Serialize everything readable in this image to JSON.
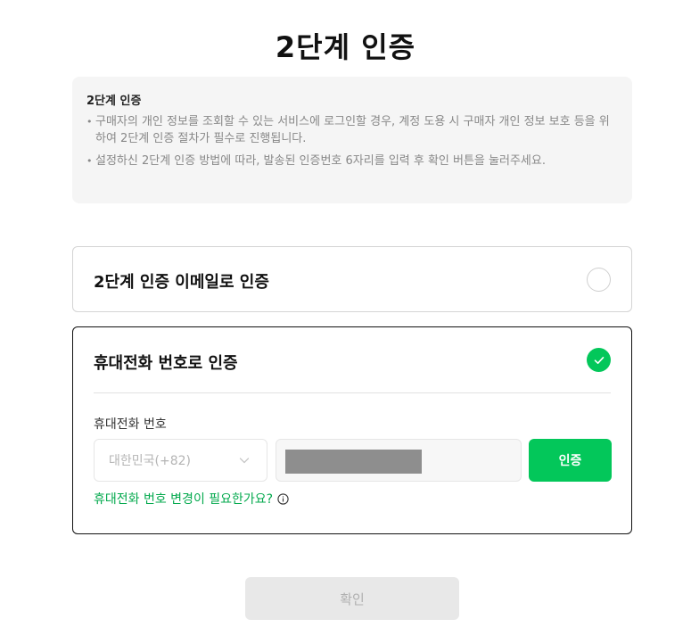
{
  "page": {
    "title": "2단계 인증"
  },
  "notice": {
    "title": "2단계 인증",
    "items": [
      "구매자의 개인 정보를 조회할 수 있는 서비스에 로그인할 경우, 계정 도용 시 구매자 개인 정보 보호 등을 위하여 2단계 인증 절차가 필수로 진행됩니다.",
      "설정하신 2단계 인증 방법에 따라, 발송된 인증번호 6자리를 입력 후 확인 버튼을 눌러주세요."
    ]
  },
  "options": {
    "email": {
      "label": "2단계 인증 이메일로 인증",
      "selected": false
    },
    "phone": {
      "label": "휴대전화 번호로 인증",
      "selected": true,
      "field_label": "휴대전화 번호",
      "country_value": "대한민국(+82)",
      "verify_label": "인증",
      "change_link": "휴대전화 번호 변경이 필요한가요?"
    }
  },
  "confirm_label": "확인",
  "colors": {
    "accent": "#03c75a",
    "link": "#03a94d",
    "disabled_bg": "#e8e8e8",
    "notice_bg": "#f5f5f5"
  },
  "icons": {
    "check": "check-icon",
    "chevron": "chevron-down-icon",
    "info": "info-icon"
  }
}
